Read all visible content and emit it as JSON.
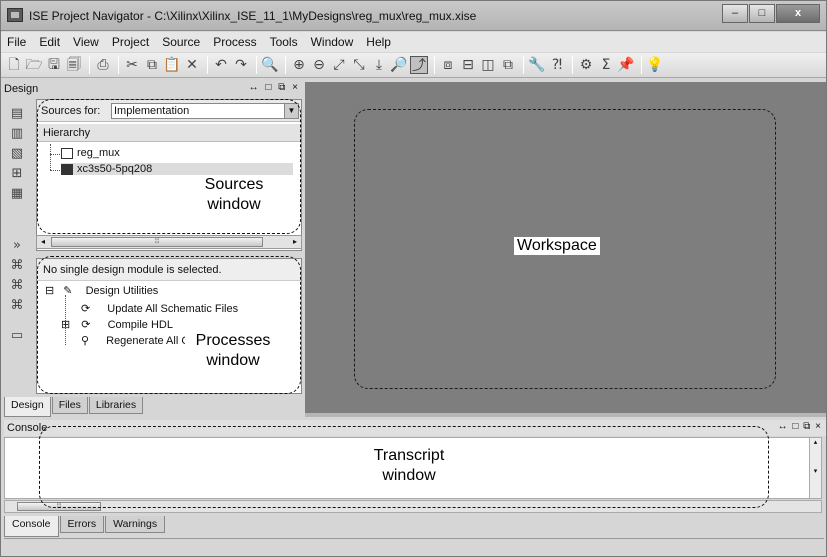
{
  "window": {
    "title": "ISE Project Navigator - C:\\Xilinx\\Xilinx_ISE_11_1\\MyDesigns\\reg_mux\\reg_mux.xise",
    "controls": {
      "minimize": "–",
      "maximize": "□",
      "close": "x"
    }
  },
  "menu": [
    "File",
    "Edit",
    "View",
    "Project",
    "Source",
    "Process",
    "Tools",
    "Window",
    "Help"
  ],
  "toolbar": {
    "icons": [
      "new-file",
      "open",
      "save",
      "save-all",
      "print",
      "cut",
      "copy",
      "paste",
      "delete",
      "undo",
      "redo",
      "find",
      "zoom-in",
      "zoom-out",
      "zoom-full",
      "zoom-fit",
      "zoom-to",
      "zoom-area",
      "select-active",
      "cascade",
      "tile-horizontal",
      "tile-vertical",
      "window-list",
      "properties",
      "help-context",
      "settings",
      "sigma",
      "pin",
      "bulb"
    ],
    "glyphs": [
      "🗋",
      "🗁",
      "🖫",
      "🗐",
      "⎙",
      "✂",
      "⧉",
      "📋",
      "✕",
      "↶",
      "↷",
      "🔍",
      "⊕",
      "⊖",
      "⤢",
      "⤡",
      "⤓",
      "🔎",
      "⤴",
      "⧈",
      "⊟",
      "◫",
      "⧉",
      "🔧",
      "⁈",
      "⚙",
      "Σ",
      "📌",
      "💡"
    ]
  },
  "design_panel": {
    "title": "Design",
    "header_controls": "↔ □ ⧉ ×",
    "sources_for_label": "Sources for:",
    "sources_for_value": "Implementation",
    "hierarchy_label": "Hierarchy",
    "tree": [
      {
        "label": "reg_mux",
        "icon": "project-icon"
      },
      {
        "label": "xc3s50-5pq208",
        "icon": "chip-icon"
      }
    ],
    "scroll_thumb": "⦙⦙⦙",
    "processes_header": "No single design module is selected.",
    "processes": [
      {
        "label": "Design Utilities",
        "icon": "tools-icon",
        "expander": "⊟"
      },
      {
        "label": "Update All Schematic Files",
        "icon": "refresh-icon"
      },
      {
        "label": "Compile HDL",
        "icon": "refresh-icon",
        "expander": "⊞"
      },
      {
        "label": "Regenerate All Cores",
        "icon": "wand-icon"
      }
    ],
    "tabs": [
      "Design",
      "Files",
      "Libraries"
    ]
  },
  "console": {
    "title": "Console",
    "controls": "↔ □ ⧉ ×",
    "tabs": [
      "Console",
      "Errors",
      "Warnings"
    ]
  },
  "annotations": {
    "sources": "Sources\nwindow",
    "processes": "Processes\nwindow",
    "workspace": "Workspace",
    "transcript": "Transcript\nwindow"
  }
}
